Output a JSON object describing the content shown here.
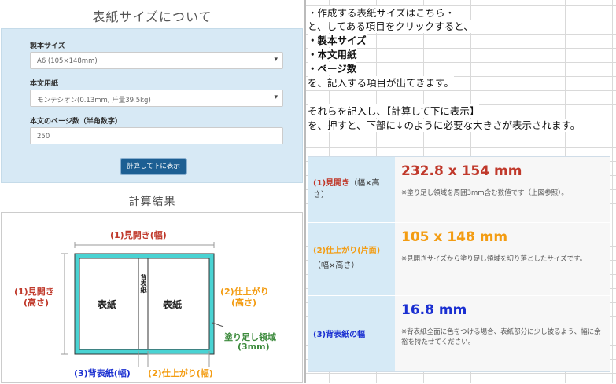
{
  "left_title": "表紙サイズについて",
  "form": {
    "binding_label": "製本サイズ",
    "binding_value": "A6 (105×148mm)",
    "paper_label": "本文用紙",
    "paper_value": "モンテシオン(0.13mm, 斤量39.5kg)",
    "pages_label": "本文のページ数（半角数字）",
    "pages_value": "250",
    "calc_button": "計算して下に表示"
  },
  "result_title": "計算結果",
  "diagram": {
    "top_label": "(1)見開き(幅)",
    "left_label_1": "(1)見開き",
    "left_label_2": "(高さ)",
    "right_label_1": "(2)仕上がり",
    "right_label_2": "(高さ)",
    "cover_left": "表紙",
    "cover_right": "表紙",
    "spine_text": "背表紙",
    "bleed_1": "塗り足し領域",
    "bleed_2": "(3mm)",
    "bottom_left": "(3)背表紙(幅)",
    "bottom_right": "(2)仕上がり(幅)"
  },
  "instructions": {
    "line1": "・作成する表紙サイズはこちら・",
    "line2": "と、してある項目をクリックすると、",
    "item1": "・製本サイズ",
    "item2": "・本文用紙",
    "item3": "・ページ数",
    "line3": "を、記入する項目が出てきます。",
    "line4": "それらを記入し、【計算して下に表示】",
    "line5": "を、押すと、下部に↓のように必要な大きさが表示されます。"
  },
  "results": [
    {
      "head_a": "(1)見開き",
      "head_b": "（幅×高さ）",
      "value": "232.8 x 154 mm",
      "note": "※塗り足し領域を周囲3mm含む数値です（上図参照）。",
      "color": "#c0392b"
    },
    {
      "head_a": "(2)仕上がり(片面)",
      "head_b": "（幅×高さ）",
      "value": "105 x 148 mm",
      "note": "※見開きサイズから塗り足し領域を切り落としたサイズです。",
      "color": "#f39c12"
    },
    {
      "head_a": "(3)背表紙の幅",
      "head_b": "",
      "value": "16.8 mm",
      "note": "※背表紙全面に色をつける場合、表紙部分に少し被るよう、幅に余裕を持たせてください。",
      "color": "#1a2fd1"
    }
  ],
  "colors": {
    "red": "#c0392b",
    "orange": "#f39c12",
    "blue": "#1a2fd1",
    "green": "#3c8a3c",
    "cyan": "#49d3d3"
  }
}
